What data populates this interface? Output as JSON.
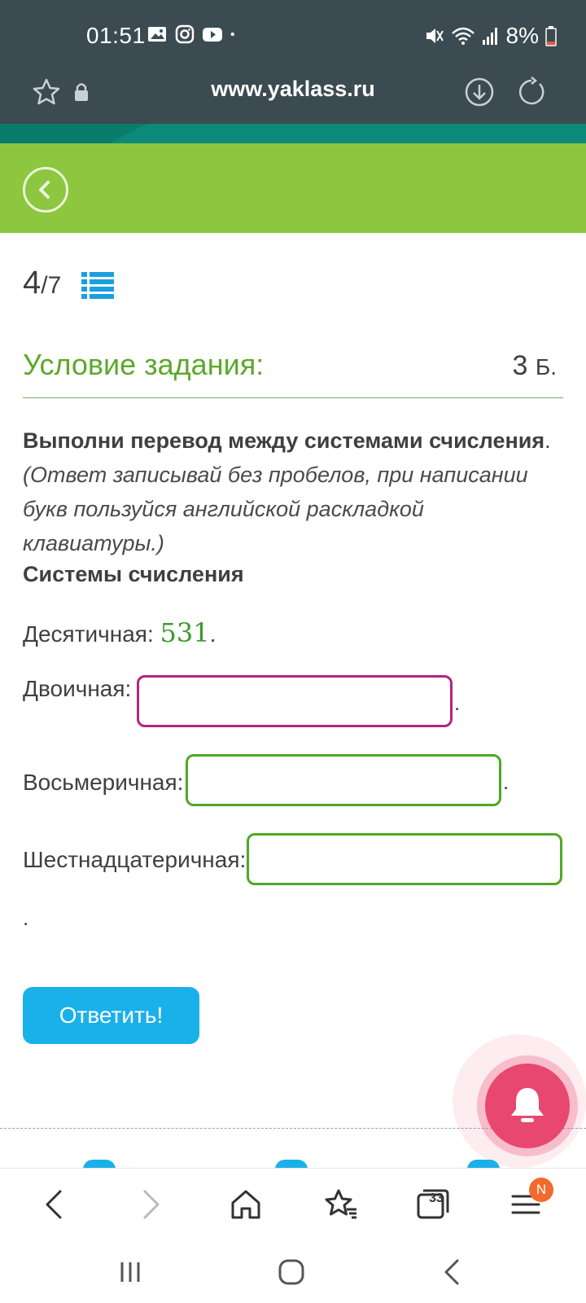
{
  "status_bar": {
    "time": "01:51",
    "battery": "8%",
    "icons": [
      "gallery-icon",
      "instagram-icon",
      "youtube-icon",
      "dot-icon",
      "mute-icon",
      "wifi-icon",
      "signal-icon",
      "battery-icon"
    ]
  },
  "browser": {
    "url": "www.yaklass.ru",
    "tab_count": "33",
    "menu_badge": "N"
  },
  "task": {
    "progress_current": "4",
    "progress_total": "/7",
    "condition_title": "Условие задания:",
    "points_value": "3",
    "points_unit": "Б.",
    "instruction_bold": "Выполни перевод между системами счисления",
    "instruction_end": ".",
    "instruction_italic": "(Ответ записывай без пробелов, при написании букв пользуйся английской раскладкой клавиатуры.)",
    "systems_title": "Системы счисления",
    "decimal_label": "Десятичная:",
    "decimal_value": "531",
    "binary_label": "Двоичная:",
    "octal_label": "Восьмеричная:",
    "hex_label": "Шестнадцатеричная:",
    "period": ".",
    "answer_button": "Ответить!"
  },
  "inputs": {
    "binary_value": "",
    "octal_value": "",
    "hex_value": ""
  },
  "colors": {
    "status_bg": "#3b4b51",
    "header_green": "#8dc63f",
    "teal": "#0c8a79",
    "title_green": "#5ca82b",
    "button_blue": "#1ab0ea",
    "active_border": "#b3257e",
    "input_border": "#4ea826",
    "bell_pink": "#e8476f"
  }
}
